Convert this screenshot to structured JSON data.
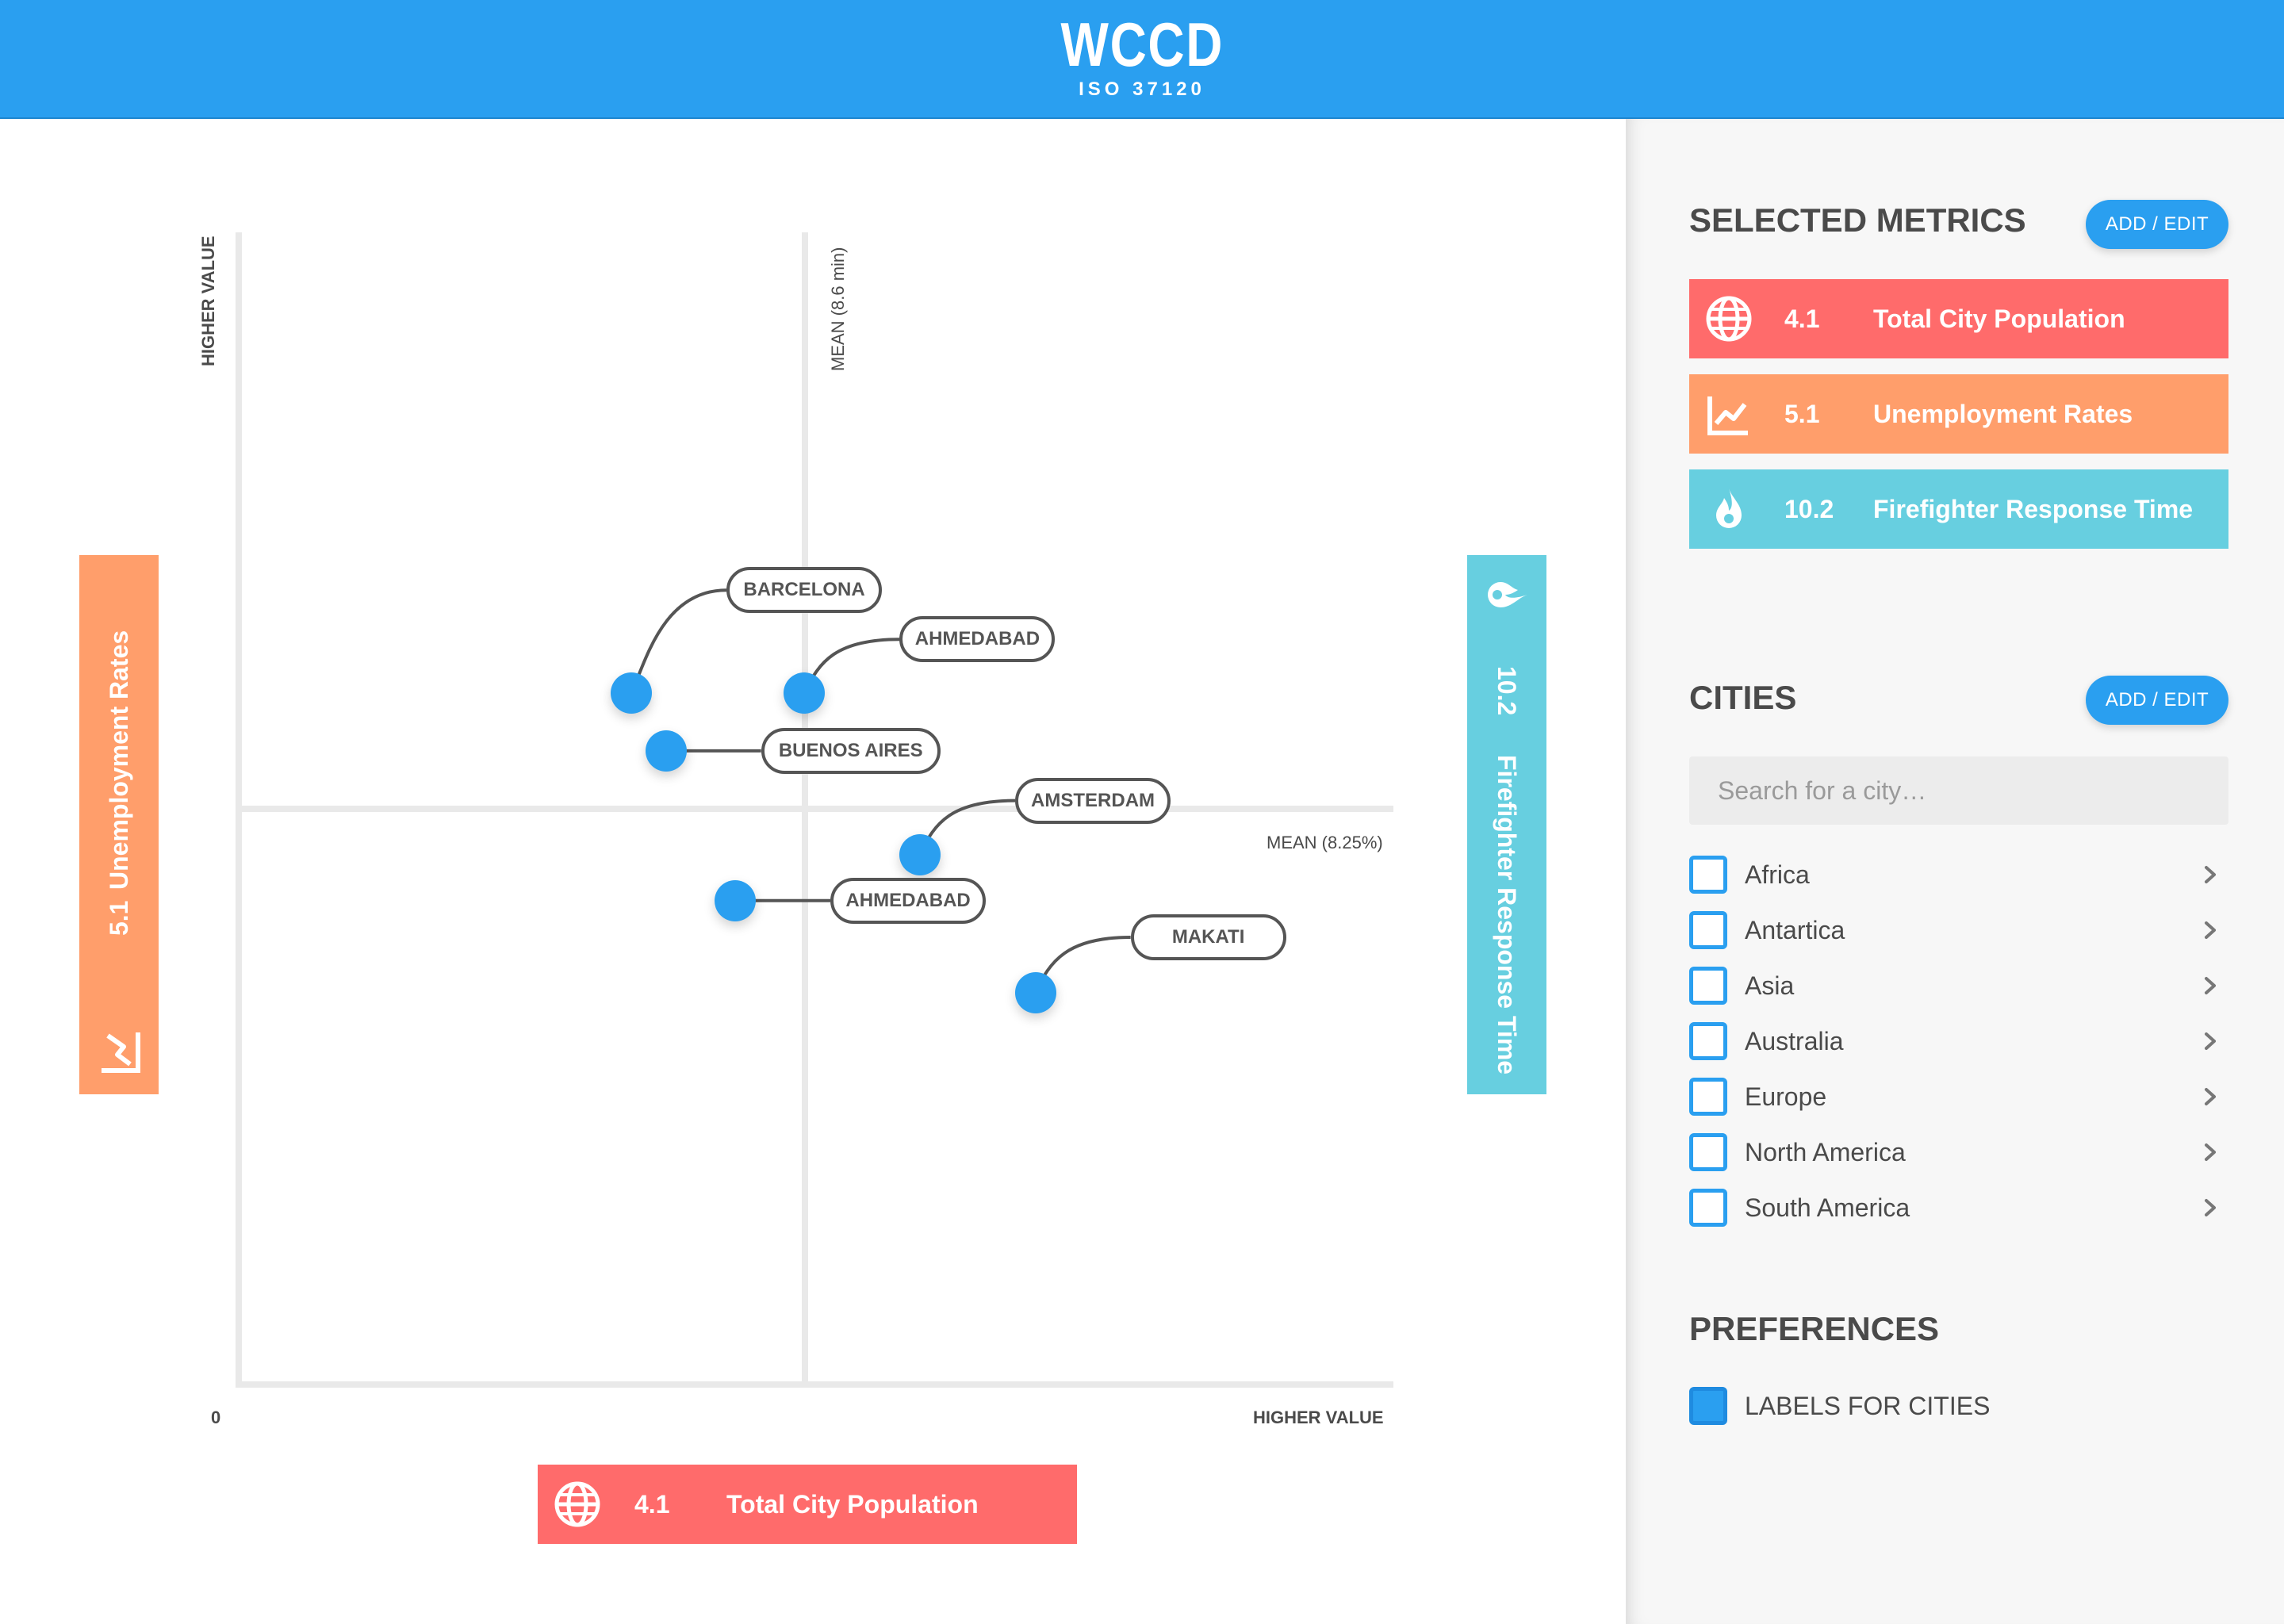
{
  "header": {
    "brand": "WCCD",
    "subtitle": "ISO 37120"
  },
  "chart": {
    "y_axis_top_label": "HIGHER VALUE",
    "x_axis_right_label": "HIGHER VALUE",
    "origin_label": "0",
    "mean_vertical_label": "MEAN  (8.6 min)",
    "mean_horizontal_label": "MEAN (8.25%)",
    "y_metric": {
      "number": "5.1",
      "label": "Unemployment Rates",
      "icon": "trend-chart-icon",
      "color": "#ff9e6b"
    },
    "x_metric": {
      "number": "4.1",
      "label": "Total City Population",
      "icon": "globe-icon",
      "color": "#ff6b6b"
    },
    "r_metric": {
      "number": "10.2",
      "label": "Firefighter Response Time",
      "icon": "flame-icon",
      "color": "#67cfe0"
    }
  },
  "chart_data": {
    "type": "scatter",
    "title": "",
    "xlabel": "Total City Population",
    "ylabel": "Unemployment Rates",
    "x_mean_label": "MEAN  (8.6 min)",
    "y_mean_label": "MEAN (8.25%)",
    "points": [
      {
        "city": "BARCELONA",
        "x": 0.34,
        "y": 0.6
      },
      {
        "city": "AHMEDABAD",
        "x": 0.49,
        "y": 0.6
      },
      {
        "city": "BUENOS AIRES",
        "x": 0.37,
        "y": 0.55
      },
      {
        "city": "AMSTERDAM",
        "x": 0.59,
        "y": 0.46
      },
      {
        "city": "AHMEDABAD",
        "x": 0.43,
        "y": 0.42
      },
      {
        "city": "MAKATI",
        "x": 0.69,
        "y": 0.34
      }
    ]
  },
  "panel": {
    "selected_metrics_title": "SELECTED METRICS",
    "add_edit_label": "ADD / EDIT",
    "metrics": [
      {
        "number": "4.1",
        "label": "Total City Population",
        "icon": "globe-icon",
        "color": "#ff6b6b"
      },
      {
        "number": "5.1",
        "label": "Unemployment Rates",
        "icon": "trend-chart-icon",
        "color": "#ff9e6b"
      },
      {
        "number": "10.2",
        "label": "Firefighter Response Time",
        "icon": "flame-icon",
        "color": "#67cfe0"
      }
    ],
    "cities_title": "CITIES",
    "cities_add_edit_label": "ADD / EDIT",
    "search_placeholder": "Search for a city…",
    "regions": [
      "Africa",
      "Antartica",
      "Asia",
      "Australia",
      "Europe",
      "North America",
      "South America"
    ],
    "preferences_title": "PREFERENCES",
    "preference_label": "LABELS FOR CITIES",
    "preference_checked": true
  }
}
